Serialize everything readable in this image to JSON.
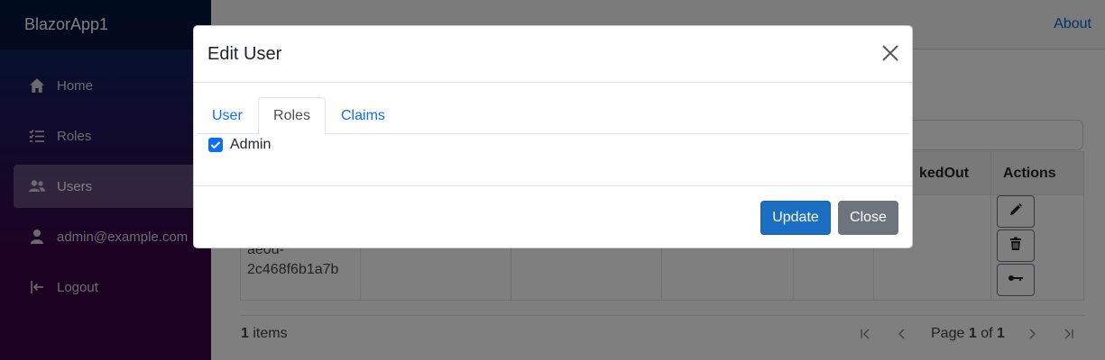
{
  "app": {
    "brand": "BlazorApp1"
  },
  "sidebar": {
    "items": [
      {
        "label": "Home",
        "icon": "home-icon"
      },
      {
        "label": "Roles",
        "icon": "list-icon"
      },
      {
        "label": "Users",
        "icon": "users-icon",
        "active": true
      },
      {
        "label": "admin@example.com",
        "icon": "person-icon"
      },
      {
        "label": "Logout",
        "icon": "logout-icon"
      }
    ]
  },
  "topbar": {
    "about_link": "About"
  },
  "grid": {
    "headers": {
      "locked_out_partial": "kedOut",
      "actions": "Actions"
    },
    "row": {
      "id_fragment_1": "ae0d-",
      "id_fragment_2": "2c468f6b1a7b"
    },
    "action_icons": [
      "pencil-icon",
      "trash-icon",
      "key-icon"
    ]
  },
  "pager": {
    "items_count": "1",
    "items_label": "items",
    "page_label": "Page",
    "current_page": "1",
    "of_label": "of",
    "total_pages": "1"
  },
  "modal": {
    "title": "Edit User",
    "tabs": [
      {
        "label": "User",
        "active": false
      },
      {
        "label": "Roles",
        "active": true
      },
      {
        "label": "Claims",
        "active": false
      }
    ],
    "role_option": {
      "label": "Admin",
      "checked": true
    },
    "update_label": "Update",
    "close_label": "Close"
  },
  "colors": {
    "primary": "#1b6ec2",
    "secondary": "#6c757d",
    "link": "#0366d6",
    "checkbox": "#0d6efd"
  }
}
